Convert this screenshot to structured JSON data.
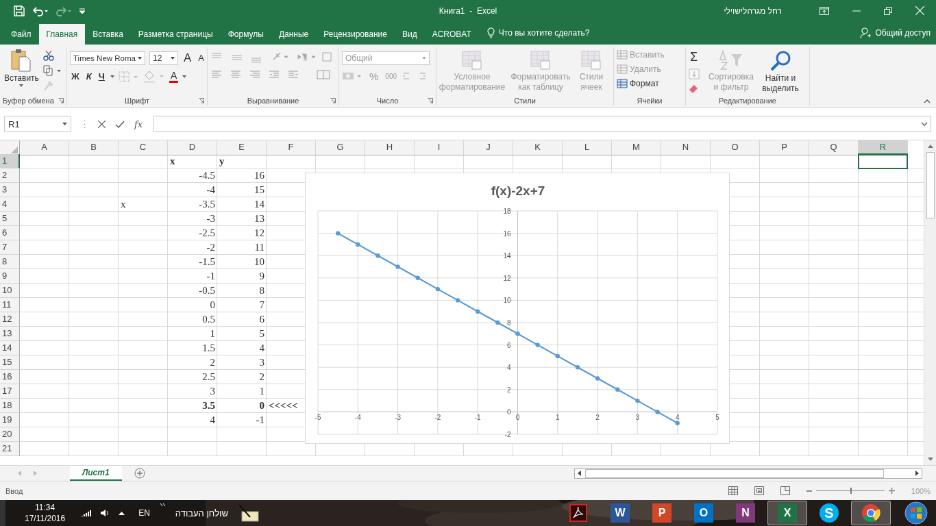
{
  "title_bar": {
    "title": "Книга1  -  Excel",
    "user": "רחל מגרהלישוילי"
  },
  "tabs": [
    {
      "label": "Файл",
      "selected": false
    },
    {
      "label": "Главная",
      "selected": true
    },
    {
      "label": "Вставка",
      "selected": false
    },
    {
      "label": "Разметка страницы",
      "selected": false
    },
    {
      "label": "Формулы",
      "selected": false
    },
    {
      "label": "Данные",
      "selected": false
    },
    {
      "label": "Рецензирование",
      "selected": false
    },
    {
      "label": "Вид",
      "selected": false
    },
    {
      "label": "ACROBAT",
      "selected": false
    }
  ],
  "tell_me": {
    "placeholder": "Что вы хотите сделать?"
  },
  "share": "Общий доступ",
  "ribbon": {
    "clipboard": {
      "label": "Буфер обмена",
      "paste": "Вставить"
    },
    "font": {
      "label": "Шрифт",
      "font_name": "Times New Roma",
      "font_size": "12",
      "grow": "A",
      "shrink": "A",
      "bold": "Ж",
      "italic": "К",
      "underline": "Ч",
      "font_color": "A"
    },
    "alignment": {
      "label": "Выравнивание"
    },
    "number": {
      "label": "Число",
      "format": "Общий",
      "percent": "%",
      "thousands": "000"
    },
    "styles": {
      "label": "Стили",
      "buttons": [
        {
          "label": "Условное форматирование",
          "disabled": true
        },
        {
          "label": "Форматировать как таблицу",
          "disabled": true
        },
        {
          "label": "Стили ячеек",
          "disabled": true
        }
      ]
    },
    "cells": {
      "label": "Ячейки",
      "buttons": [
        {
          "label": "Вставить",
          "disabled": true
        },
        {
          "label": "Удалить",
          "disabled": true
        },
        {
          "label": "Формат",
          "disabled": false
        }
      ]
    },
    "editing": {
      "label": "Редактирование",
      "sum": "Σ",
      "buttons": [
        {
          "label": "Сортировка и фильтр",
          "disabled": true
        },
        {
          "label": "Найти и выделить",
          "disabled": false
        }
      ]
    }
  },
  "formula_bar": {
    "name_box": "R1",
    "fx": "fx"
  },
  "columns": [
    {
      "label": "A",
      "selected": false
    },
    {
      "label": "B",
      "selected": false
    },
    {
      "label": "C",
      "selected": false
    },
    {
      "label": "D",
      "selected": false
    },
    {
      "label": "E",
      "selected": false
    },
    {
      "label": "F",
      "selected": false
    },
    {
      "label": "G",
      "selected": false
    },
    {
      "label": "H",
      "selected": false
    },
    {
      "label": "I",
      "selected": false
    },
    {
      "label": "J",
      "selected": false
    },
    {
      "label": "K",
      "selected": false
    },
    {
      "label": "L",
      "selected": false
    },
    {
      "label": "M",
      "selected": false
    },
    {
      "label": "N",
      "selected": false
    },
    {
      "label": "O",
      "selected": false
    },
    {
      "label": "P",
      "selected": false
    },
    {
      "label": "Q",
      "selected": false
    },
    {
      "label": "R",
      "selected": true
    }
  ],
  "rows": [
    {
      "number": "1",
      "selected": true,
      "cells": [
        null,
        null,
        null,
        {
          "text": "x",
          "kind": "text",
          "bold": true
        },
        {
          "text": "y",
          "kind": "text",
          "bold": true
        }
      ]
    },
    {
      "number": "2",
      "selected": false,
      "cells": [
        null,
        null,
        null,
        {
          "text": "-4.5",
          "kind": "number",
          "bold": false
        },
        {
          "text": "16",
          "kind": "number",
          "bold": false
        }
      ]
    },
    {
      "number": "3",
      "selected": false,
      "cells": [
        null,
        null,
        null,
        {
          "text": "-4",
          "kind": "number",
          "bold": false
        },
        {
          "text": "15",
          "kind": "number",
          "bold": false
        }
      ]
    },
    {
      "number": "4",
      "selected": false,
      "cells": [
        null,
        null,
        {
          "text": "x",
          "kind": "text",
          "bold": false
        },
        {
          "text": "-3.5",
          "kind": "number",
          "bold": false
        },
        {
          "text": "14",
          "kind": "number",
          "bold": false
        }
      ]
    },
    {
      "number": "5",
      "selected": false,
      "cells": [
        null,
        null,
        null,
        {
          "text": "-3",
          "kind": "number",
          "bold": false
        },
        {
          "text": "13",
          "kind": "number",
          "bold": false
        }
      ]
    },
    {
      "number": "6",
      "selected": false,
      "cells": [
        null,
        null,
        null,
        {
          "text": "-2.5",
          "kind": "number",
          "bold": false
        },
        {
          "text": "12",
          "kind": "number",
          "bold": false
        }
      ]
    },
    {
      "number": "7",
      "selected": false,
      "cells": [
        null,
        null,
        null,
        {
          "text": "-2",
          "kind": "number",
          "bold": false
        },
        {
          "text": "11",
          "kind": "number",
          "bold": false
        }
      ]
    },
    {
      "number": "8",
      "selected": false,
      "cells": [
        null,
        null,
        null,
        {
          "text": "-1.5",
          "kind": "number",
          "bold": false
        },
        {
          "text": "10",
          "kind": "number",
          "bold": false
        }
      ]
    },
    {
      "number": "9",
      "selected": false,
      "cells": [
        null,
        null,
        null,
        {
          "text": "-1",
          "kind": "number",
          "bold": false
        },
        {
          "text": "9",
          "kind": "number",
          "bold": false
        }
      ]
    },
    {
      "number": "10",
      "selected": false,
      "cells": [
        null,
        null,
        null,
        {
          "text": "-0.5",
          "kind": "number",
          "bold": false
        },
        {
          "text": "8",
          "kind": "number",
          "bold": false
        }
      ]
    },
    {
      "number": "11",
      "selected": false,
      "cells": [
        null,
        null,
        null,
        {
          "text": "0",
          "kind": "number",
          "bold": false
        },
        {
          "text": "7",
          "kind": "number",
          "bold": false
        }
      ]
    },
    {
      "number": "12",
      "selected": false,
      "cells": [
        null,
        null,
        null,
        {
          "text": "0.5",
          "kind": "number",
          "bold": false
        },
        {
          "text": "6",
          "kind": "number",
          "bold": false
        }
      ]
    },
    {
      "number": "13",
      "selected": false,
      "cells": [
        null,
        null,
        null,
        {
          "text": "1",
          "kind": "number",
          "bold": false
        },
        {
          "text": "5",
          "kind": "number",
          "bold": false
        }
      ]
    },
    {
      "number": "14",
      "selected": false,
      "cells": [
        null,
        null,
        null,
        {
          "text": "1.5",
          "kind": "number",
          "bold": false
        },
        {
          "text": "4",
          "kind": "number",
          "bold": false
        }
      ]
    },
    {
      "number": "15",
      "selected": false,
      "cells": [
        null,
        null,
        null,
        {
          "text": "2",
          "kind": "number",
          "bold": false
        },
        {
          "text": "3",
          "kind": "number",
          "bold": false
        }
      ]
    },
    {
      "number": "16",
      "selected": false,
      "cells": [
        null,
        null,
        null,
        {
          "text": "2.5",
          "kind": "number",
          "bold": false
        },
        {
          "text": "2",
          "kind": "number",
          "bold": false
        }
      ]
    },
    {
      "number": "17",
      "selected": false,
      "cells": [
        null,
        null,
        null,
        {
          "text": "3",
          "kind": "number",
          "bold": false
        },
        {
          "text": "1",
          "kind": "number",
          "bold": false
        }
      ]
    },
    {
      "number": "18",
      "selected": false,
      "cells": [
        null,
        null,
        null,
        {
          "text": "3.5",
          "kind": "number",
          "bold": true
        },
        {
          "text": "0",
          "kind": "number",
          "bold": true
        },
        {
          "text": "<<<<<",
          "kind": "text",
          "bold": true
        }
      ]
    },
    {
      "number": "19",
      "selected": false,
      "cells": [
        null,
        null,
        null,
        {
          "text": "4",
          "kind": "number",
          "bold": false
        },
        {
          "text": "-1",
          "kind": "number",
          "bold": false
        }
      ]
    },
    {
      "number": "20",
      "selected": false
    },
    {
      "number": "21",
      "selected": false
    }
  ],
  "chart": {
    "chart_data": {
      "type": "line",
      "title": "f(x)-2x+7",
      "grid": true,
      "x": [
        -4.5,
        -4,
        -3.5,
        -3,
        -2.5,
        -2,
        -1.5,
        -1,
        -0.5,
        0,
        0.5,
        1,
        1.5,
        2,
        2.5,
        3,
        3.5,
        4
      ],
      "series": [
        {
          "color": "#5b9bd5",
          "marker": "circle",
          "values": [
            16,
            15,
            14,
            13,
            12,
            11,
            10,
            9,
            8,
            7,
            6,
            5,
            4,
            3,
            2,
            1,
            0,
            -1
          ]
        }
      ],
      "xlim": [
        -5,
        5
      ],
      "ylim": [
        -2,
        18
      ],
      "xticks": [
        {
          "value": -5,
          "label": "-5"
        },
        {
          "value": -4,
          "label": "-4"
        },
        {
          "value": -3,
          "label": "-3"
        },
        {
          "value": -2,
          "label": "-2"
        },
        {
          "value": -1,
          "label": "-1"
        },
        {
          "value": 0,
          "label": "0"
        },
        {
          "value": 1,
          "label": "1"
        },
        {
          "value": 2,
          "label": "2"
        },
        {
          "value": 3,
          "label": "3"
        },
        {
          "value": 4,
          "label": "4"
        },
        {
          "value": 5,
          "label": "5"
        }
      ],
      "yticks": [
        {
          "value": -2,
          "label": "-2"
        },
        {
          "value": 0,
          "label": "0"
        },
        {
          "value": 2,
          "label": "2"
        },
        {
          "value": 4,
          "label": "4"
        },
        {
          "value": 6,
          "label": "6"
        },
        {
          "value": 8,
          "label": "8"
        },
        {
          "value": 10,
          "label": "10"
        },
        {
          "value": 12,
          "label": "12"
        },
        {
          "value": 14,
          "label": "14"
        },
        {
          "value": 16,
          "label": "16"
        },
        {
          "value": 18,
          "label": "18"
        }
      ]
    }
  },
  "sheet_tabs": [
    {
      "label": "Лист1",
      "selected": true
    }
  ],
  "status_bar": {
    "mode": "Ввод",
    "zoom": {
      "reading": "100%",
      "level": 0.5
    }
  },
  "taskbar": {
    "time": "11:34",
    "date": "17/11/2016",
    "language": "EN",
    "toolbar": "שולחן העבודה",
    "apps": [
      {
        "kind": "acrobat",
        "active": false
      },
      {
        "kind": "word",
        "glyph": "W",
        "active": false
      },
      {
        "kind": "powerpoint",
        "glyph": "P",
        "active": false
      },
      {
        "kind": "outlook",
        "glyph": "O",
        "active": false
      },
      {
        "kind": "onenote",
        "glyph": "N",
        "active": false
      },
      {
        "kind": "excel",
        "glyph": "X",
        "active": true
      },
      {
        "kind": "skype",
        "glyph": "S",
        "active": false
      },
      {
        "kind": "chrome",
        "active": true
      }
    ]
  }
}
